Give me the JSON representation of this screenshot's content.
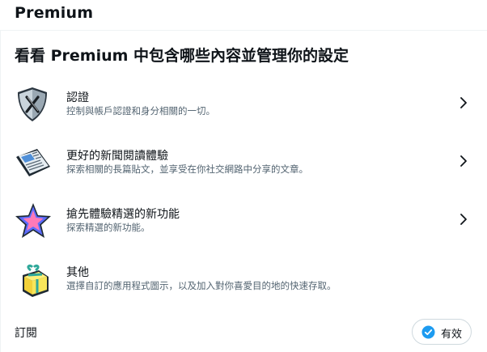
{
  "header": {
    "title": "Premium"
  },
  "subtitle": "看看 Premium 中包含哪些內容並管理你的設定",
  "features": [
    {
      "title": "認證",
      "description": "控制與帳戶認證和身分相關的一切。",
      "icon": "verification-shield-icon",
      "has_chevron": true
    },
    {
      "title": "更好的新聞閱讀體驗",
      "description": "探索相關的長篇貼文，並享受在你社交網路中分享的文章。",
      "icon": "newspaper-icon",
      "has_chevron": true
    },
    {
      "title": "搶先體驗精選的新功能",
      "description": "探索精選的新功能。",
      "icon": "star-icon",
      "has_chevron": true
    },
    {
      "title": "其他",
      "description": "選擇自訂的應用程式圖示，以及加入對你喜愛目的地的快速存取。",
      "icon": "gift-box-icon",
      "has_chevron": false
    }
  ],
  "subscription": {
    "label": "訂閱",
    "status": "有效"
  },
  "colors": {
    "accent": "#1d9bf0",
    "secondary_text": "#536471",
    "border": "#cfd9de"
  }
}
